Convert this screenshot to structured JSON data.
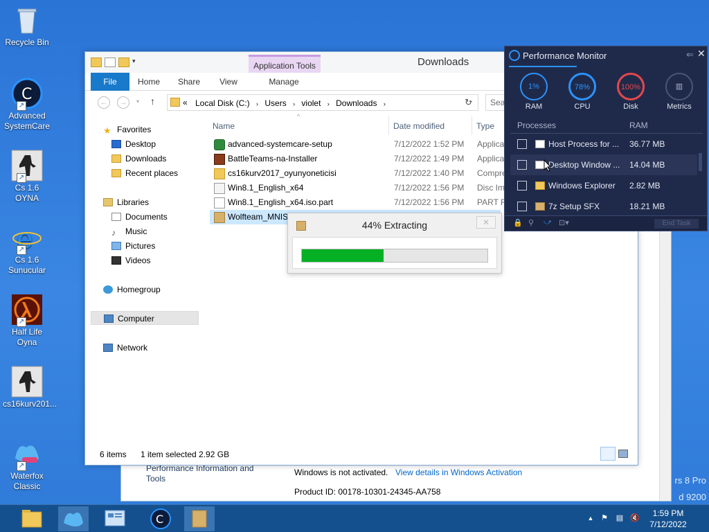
{
  "desktop_icons": [
    {
      "label": "Recycle Bin"
    },
    {
      "label": "Advanced SystemCare"
    },
    {
      "label": "Cs 1.6 OYNA"
    },
    {
      "label": "Cs 1.6 Sunucular"
    },
    {
      "label": "Half Life Oyna"
    },
    {
      "label": "cs16kurv201..."
    },
    {
      "label": "Waterfox Classic"
    }
  ],
  "background_window": {
    "perf_info_label": "Performance Information and Tools",
    "activation_text": "Windows is not activated.",
    "activation_link": "View details in Windows Activation",
    "product_id": "Product ID:  00178-10301-24345-AA758"
  },
  "watermark": {
    "line1": "rs 8 Pro",
    "line2": "d 9200"
  },
  "explorer": {
    "window_title": "Downloads",
    "context_tab": "Application Tools",
    "ribbon_tabs": [
      "File",
      "Home",
      "Share",
      "View",
      "Manage"
    ],
    "address": {
      "prefix": "«",
      "crumbs": [
        "Local Disk (C:)",
        "Users",
        "violet",
        "Downloads"
      ]
    },
    "search_placeholder": "Sea",
    "nav": {
      "favorites": "Favorites",
      "desktop": "Desktop",
      "downloads": "Downloads",
      "recent": "Recent places",
      "libraries": "Libraries",
      "documents": "Documents",
      "music": "Music",
      "pictures": "Pictures",
      "videos": "Videos",
      "homegroup": "Homegroup",
      "computer": "Computer",
      "network": "Network"
    },
    "columns": {
      "name": "Name",
      "date": "Date modified",
      "type": "Type"
    },
    "files": [
      {
        "name": "advanced-systemcare-setup",
        "date": "7/12/2022 1:52 PM",
        "type": "Applica",
        "icon": "installer-icon"
      },
      {
        "name": "BattleTeams-na-Installer",
        "date": "7/12/2022 1:49 PM",
        "type": "Applica",
        "icon": "game-icon"
      },
      {
        "name": "cs16kurv2017_oyunyoneticisi",
        "date": "7/12/2022 1:40 PM",
        "type": "Compre",
        "icon": "zip-folder-icon"
      },
      {
        "name": "Win8.1_English_x64",
        "date": "7/12/2022 1:56 PM",
        "type": "Disc Im",
        "icon": "disc-image-icon"
      },
      {
        "name": "Win8.1_English_x64.iso.part",
        "date": "7/12/2022 1:56 PM",
        "type": "PART F",
        "icon": "file-icon"
      },
      {
        "name": "Wolfteam_MNIS",
        "date": "",
        "type": "",
        "icon": "archive-icon"
      }
    ],
    "status": {
      "items": "6 items",
      "selected": "1 item selected  2.92 GB"
    }
  },
  "extract_dialog": {
    "title": "44% Extracting",
    "progress": 0.44,
    "close": "✕"
  },
  "perf_monitor": {
    "title": "Performance Monitor",
    "gauges": [
      {
        "value": "1%",
        "label": "RAM",
        "color": "#2b93ff"
      },
      {
        "value": "78%",
        "label": "CPU",
        "color": "#2b93ff"
      },
      {
        "value": "100%",
        "label": "Disk",
        "color": "#e5484d"
      },
      {
        "value": "",
        "label": "Metrics",
        "color": "#4a5578"
      }
    ],
    "columns": {
      "processes": "Processes",
      "ram": "RAM"
    },
    "processes": [
      {
        "name": "Host Process for ...",
        "ram": "36.77 MB"
      },
      {
        "name": "Desktop Window ...",
        "ram": "14.04 MB"
      },
      {
        "name": "Windows Explorer",
        "ram": "2.82 MB"
      },
      {
        "name": "7z Setup SFX",
        "ram": "18.21 MB"
      }
    ],
    "end_task": "End Task"
  },
  "taskbar": {
    "time": "1:59 PM",
    "date": "7/12/2022"
  }
}
